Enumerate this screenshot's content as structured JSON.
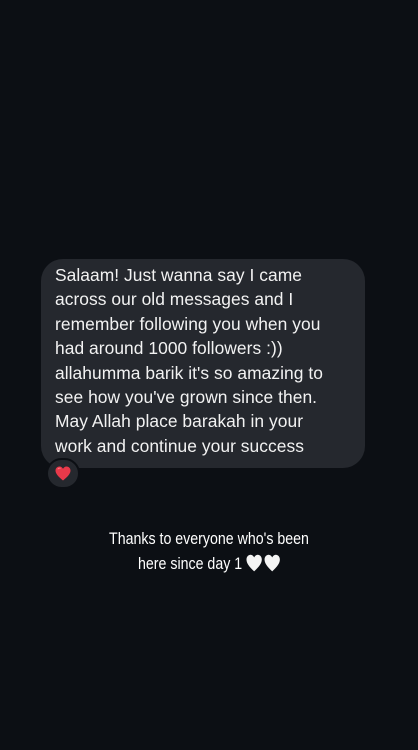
{
  "message": {
    "text": "Salaam! Just wanna say I came\nacross our old messages and I\nremember following you when you\nhad around 1000 followers :))\nallahumma barik it's so amazing to\nsee how you've grown since then.\nMay Allah place barakah in your\nwork and continue your success",
    "reaction_icon": "red-heart",
    "bubble_color": "#25282e",
    "text_color": "#f2f2f2"
  },
  "caption": {
    "line1": "Thanks to everyone who's been",
    "line2": "here since day 1",
    "trailing_icons": [
      "white-heart",
      "white-heart"
    ],
    "text_color": "#ffffff"
  },
  "theme": {
    "background": "#0c0f14",
    "reaction_heart_color": "#e8394a",
    "white_heart_color": "#f4f4f4"
  }
}
